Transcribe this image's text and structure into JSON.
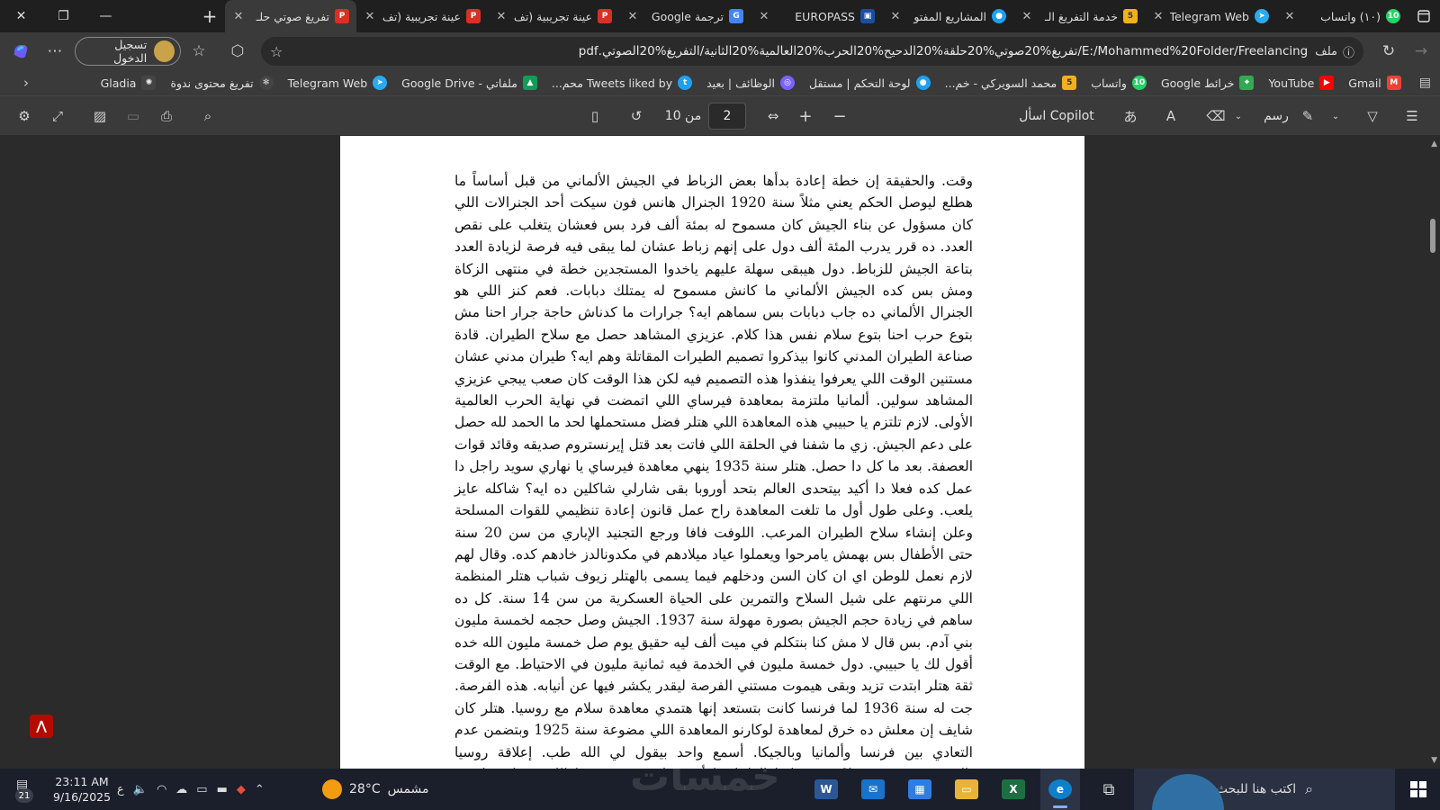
{
  "tabs": [
    {
      "label": "(١٠) واتساب",
      "favicon": "whatsapp-icon",
      "color": "#25D366"
    },
    {
      "label": "Telegram Web",
      "favicon": "telegram-icon",
      "color": "#2AABEE"
    },
    {
      "label": "خدمة التفريغ الـ",
      "favicon": "khamsat-icon",
      "color": "#F2B01E"
    },
    {
      "label": "المشاريع المفتو",
      "favicon": "mostaql-icon",
      "color": "#1DA1F2"
    },
    {
      "label": "EUROPASS",
      "favicon": "europass-icon",
      "color": "#1A4FA0"
    },
    {
      "label": "ترجمة Google",
      "favicon": "google-translate-icon",
      "color": "#4285F4"
    },
    {
      "label": "عينة تجريبية (تف",
      "favicon": "pdf-icon",
      "color": "#D93025"
    },
    {
      "label": "عينة تجريبية (تف",
      "favicon": "pdf-icon",
      "color": "#D93025"
    },
    {
      "label": "تفريغ صوتي حلـ",
      "favicon": "pdf-icon",
      "color": "#D93025",
      "active": true
    }
  ],
  "address": {
    "label": "ملف",
    "url": "E:/Mohammed%20Folder/Freelancing/تفريغ%20صوتي%20حلقة%20الدحيح%20الحرب%20العالمية%20الثانية/التفريغ%20الصوتي.pdf",
    "signin": "تسجيل الدخول"
  },
  "bookmarks": [
    {
      "label": "Gmail",
      "icon": "gmail-icon",
      "color": "#EA4335"
    },
    {
      "label": "YouTube",
      "icon": "youtube-icon",
      "color": "#FF0000"
    },
    {
      "label": "خرائط Google",
      "icon": "google-maps-icon",
      "color": "#34A853"
    },
    {
      "label": "واتساب",
      "icon": "whatsapp-icon",
      "color": "#25D366"
    },
    {
      "label": "محمد السويركي - خم...",
      "icon": "khamsat-icon",
      "color": "#F2B01E"
    },
    {
      "label": "لوحة التحكم | مستقل",
      "icon": "mostaql-icon",
      "color": "#1DA1F2"
    },
    {
      "label": "الوظائف | بعيد",
      "icon": "baaeed-icon",
      "color": "#7B61FF"
    },
    {
      "label": "Tweets liked by محم...",
      "icon": "twitter-icon",
      "color": "#1DA1F2"
    },
    {
      "label": "ملفاتي - Google Drive",
      "icon": "google-drive-icon",
      "color": "#0F9D58"
    },
    {
      "label": "Telegram Web",
      "icon": "telegram-icon",
      "color": "#2AABEE"
    },
    {
      "label": "تفريغ محتوى ندوة",
      "icon": "chatgpt-icon",
      "color": "#bbbbbb"
    },
    {
      "label": "Gladia",
      "icon": "gladia-icon",
      "color": "#dddddd"
    }
  ],
  "pdf_toolbar": {
    "ask_copilot": "اسأل Copilot",
    "draw_label": "رسم",
    "current_page": "2",
    "of_pages": "من 10"
  },
  "document": {
    "text": "وقت. والحقيقة إن خطة إعادة بدأها بعض الزباط في الجيش الألماني من قبل أساساً ما هطلع ليوصل الحكم يعني مثلاً سنة 1920 الجنرال هانس فون سيكت أحد الجنرالات اللي كان مسؤول عن بناء الجيش كان مسموح له بمئة ألف فرد بس فعشان يتغلب على نقص العدد. ده قرر يدرب المئة ألف دول على إنهم زباط عشان لما يبقى فيه فرصة لزيادة العدد بتاعة الجيش للزباط. دول هيبقى سهلة عليهم ياخدوا المستجدين خطة في منتهى الزكاة ومش بس كده الجيش الألماني ما كانش مسموح له يمتلك دبابات. فعم كنز اللي هو الجنرال الألماني ده جاب دبابات بس سماهم ايه؟ جرارات ما كدناش حاجة جرار احنا مش بتوع حرب احنا بتوع سلام نفس هذا كلام. عزيزي المشاهد حصل مع سلاح الطيران. قادة صناعة الطيران المدني كانوا بيذكروا تصميم الطيرات المقاتلة وهم ايه؟ طيران مدني عشان مستنين الوقت اللي يعرفوا ينفذوا هذه التصميم فيه لكن هذا الوقت كان صعب يبجي عزيزي المشاهد سولين. ألمانيا ملتزمة بمعاهدة فيرساي اللي اتمضت في نهاية الحرب العالمية الأولى. لازم تلتزم يا حبيبي هذه المعاهدة اللي هتلر فضل مستحملها لحد ما الحمد لله حصل على دعم الجيش. زي ما شفنا في الحلقة اللي فاتت بعد قتل إيرنستروم صديقه وقائد قوات العصفة. بعد ما كل دا حصل. هتلر سنة 1935 ينهي معاهدة فيرساي يا نهاري سويد راجل دا عمل كده فعلا دا أكيد بيتحدى العالم بتحد أوروبا بقى شارلي شاكلين ده ايه؟ شاكله عايز يلعب. وعلى طول أول ما تلغت المعاهدة راح عمل قانون إعادة تنظيمي للقوات المسلحة وعلن إنشاء سلاح الطيران المرعب. اللوفت فافا ورجع التجنيد الإباري من سن 20 سنة حتى الأطفال بس بهمش يامرحوا ويعملوا عياد ميلادهم في مكدونالدز خادهم كده. وقال لهم لازم نعمل للوطن اي ان كان السن ودخلهم فيما يسمى بالهتلر زيوف شباب هتلر المنظمة اللي مرنتهم على شيل السلاح والتمرين على الحياة العسكرية من سن 14 سنة. كل ده ساهم في زيادة حجم الجيش بصورة مهولة سنة 1937. الجيش وصل حجمه لخمسة مليون بني آدم. بس قال لا مش كنا بنتكلم في ميت ألف ليه حقيق يوم صل خمسة مليون الله خده أقول لك يا حبيبي. دول خمسة مليون في الخدمة فيه ثمانية مليون في الاحتياط. مع الوقت ثقة هتلر ابتدت تزيد وبقى هيموت مستني الفرصة ليقدر يكشر فيها عن أنيابه. هذه الفرصة. جت له سنة 1936 لما فرنسا كانت بتستعد إنها هتمدي معاهدة سلام مع روسيا. هتلر كان شايف إن معلش ده خرق لمعاهدة لوكارنو المعاهدة اللي مضوعة سنة 1925 وبتضمن عدم التعادي بين فرنسا وألمانيا وبالجيكا. أسمع واحد بيقول لي الله طب. إعلاقة روسيا بالموضوع فين روسيا؟ ويرز راشا الراجل يا أخي ما بيحبش روسيا الله يحبها غزبا عنه ويتلكت فأمر بيعادل. تمركز الجنود في منطقة راين لاند زي ما انا شايف في الخريطة اللي شايفها لو افتكرنا النسبة في معاهدة راين لاند كانت منزوعة السلاح"
  },
  "taskbar": {
    "search_placeholder": "اكتب هنا للبحث",
    "weather_temp": "28°C",
    "weather_desc": "مشمس",
    "time": "23:11 AM",
    "date": "9/16/2025",
    "keyboard": "ع",
    "notifications": "21"
  },
  "watermark": "خمسات"
}
